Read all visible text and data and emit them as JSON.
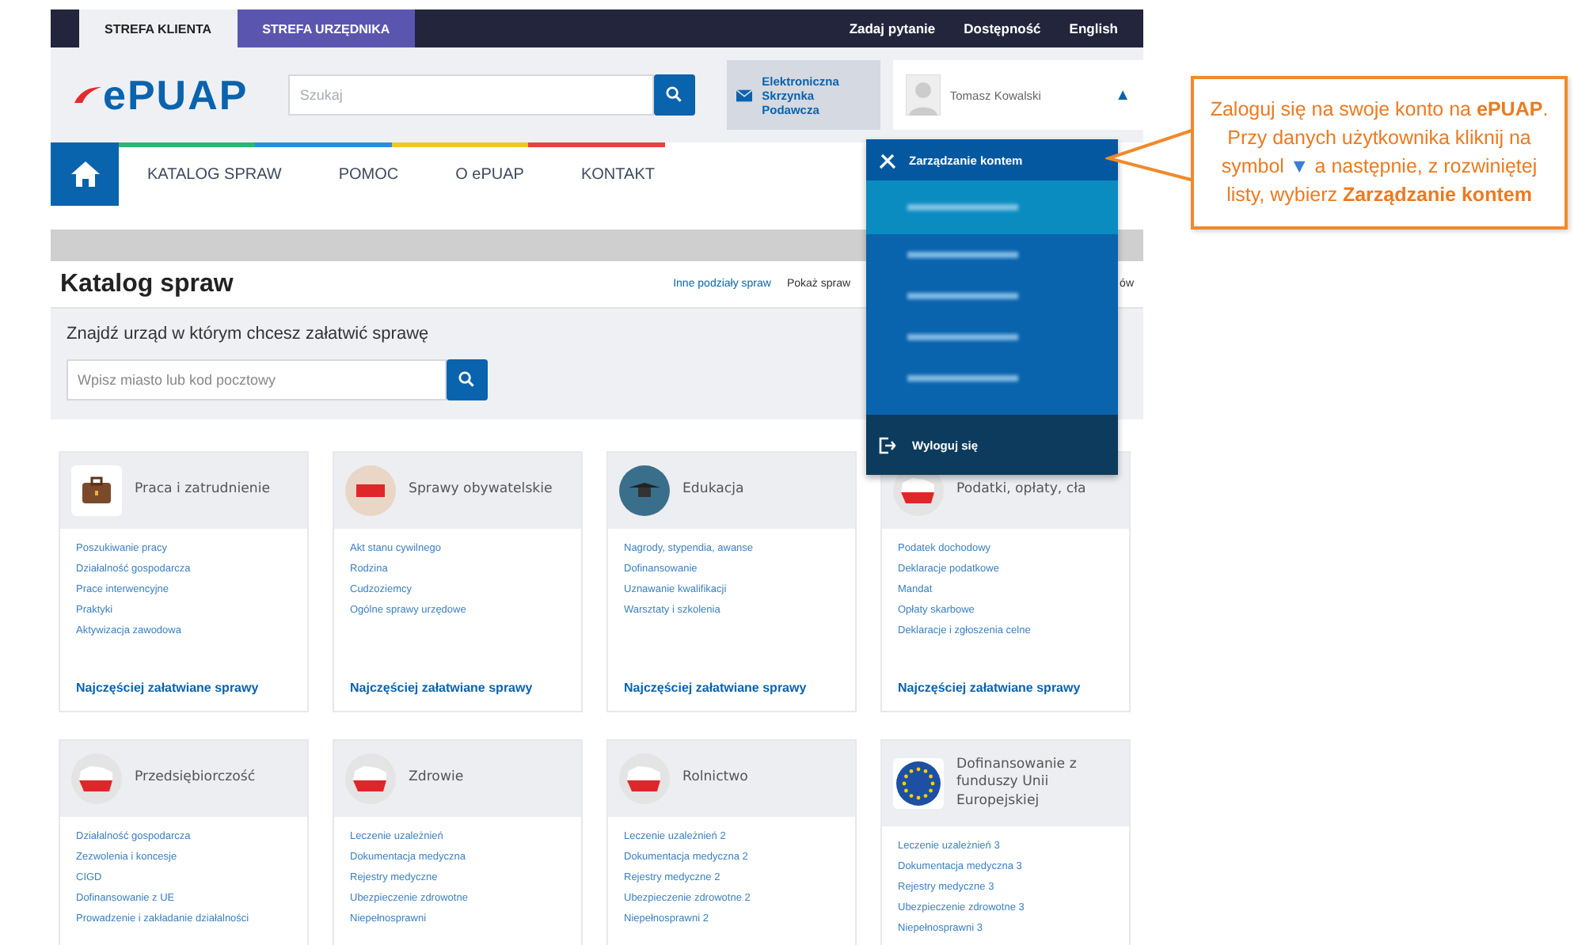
{
  "top_bar": {
    "tabs": [
      {
        "label": "STREFA KLIENTA",
        "selected": true
      },
      {
        "label": "STREFA URZĘDNIKA",
        "selected": false
      }
    ],
    "links": [
      "Zadaj pytanie",
      "Dostępność",
      "English"
    ]
  },
  "header": {
    "logo": "ePUAP",
    "search": {
      "placeholder": "Szukaj"
    },
    "inbox": "Elektroniczna Skrzynka Podawcza",
    "user": {
      "first_name": "Tomasz",
      "last_name": "Kowalski",
      "caret": "▲",
      "expanded": true
    }
  },
  "nav": [
    "KATALOG SPRAW",
    "POMOC",
    "O ePUAP",
    "KONTAKT"
  ],
  "user_menu": {
    "items": [
      {
        "label": "Zarządzanie kontem",
        "selected": true
      }
    ],
    "hidden_items": [
      {
        "highlighted": true
      },
      {
        "highlighted": false
      },
      {
        "highlighted": false
      },
      {
        "highlighted": false
      },
      {
        "highlighted": false
      }
    ],
    "logout": "Wyloguj się"
  },
  "catalog": {
    "title": "Katalog spraw",
    "links": [
      "Inne podziały spraw",
      "Pokaż spraw",
      "ów"
    ],
    "finder": {
      "label": "Znajdź urząd w którym chcesz załatwić sprawę",
      "placeholder": "Wpisz miasto lub kod pocztowy"
    },
    "categories": [
      {
        "title": "Praca i zatrudnienie",
        "kind": "briefcase",
        "items": [
          "Poszukiwanie pracy",
          "Działalność gospodarcza",
          "Prace interwencyjne",
          "Praktyki",
          "Aktywizacja zawodowa"
        ],
        "footer": "Najczęściej załatwiane sprawy"
      },
      {
        "title": "Sprawy obywatelskie",
        "kind": "sign",
        "items": [
          "Akt stanu cywilnego",
          "Rodzina",
          "Cudzoziemcy",
          "Ogólne sprawy urzędowe"
        ],
        "footer": "Najczęściej załatwiane sprawy"
      },
      {
        "title": "Edukacja",
        "kind": "cap",
        "items": [
          "Nagrody, stypendia, awanse",
          "Dofinansowanie",
          "Uznawanie kwalifikacji",
          "Warsztaty i szkolenia"
        ],
        "footer": "Najczęściej załatwiane sprawy"
      },
      {
        "title": "Podatki, opłaty, cła",
        "kind": "map",
        "items": [
          "Podatek dochodowy",
          "Deklaracje podatkowe",
          "Mandat",
          "Opłaty skarbowe",
          "Deklaracje i zgłoszenia celne"
        ],
        "footer": "Najczęściej załatwiane sprawy"
      },
      {
        "title": "Przedsiębiorczość",
        "kind": "map",
        "items": [
          "Działalność gospodarcza",
          "Zezwolenia i koncesje",
          "CIGD",
          "Dofinansowanie z UE",
          "Prowadzenie i zakładanie działalności"
        ]
      },
      {
        "title": "Zdrowie",
        "kind": "map",
        "items": [
          "Leczenie uzależnień",
          "Dokumentacja medyczna",
          "Rejestry medyczne",
          "Ubezpieczenie zdrowotne",
          "Niepełnosprawni"
        ]
      },
      {
        "title": "Rolnictwo",
        "kind": "map",
        "items": [
          "Leczenie uzależnień 2",
          "Dokumentacja medyczna 2",
          "Rejestry medyczne 2",
          "Ubezpieczenie zdrowotne 2",
          "Niepełnosprawni 2"
        ]
      },
      {
        "title": "Dofinansowanie z funduszy Unii Europejskiej",
        "kind": "eu",
        "items": [
          "Leczenie uzależnień 3",
          "Dokumentacja medyczna 3",
          "Rejestry medyczne 3",
          "Ubezpieczenie zdrowotne 3",
          "Niepełnosprawni 3"
        ]
      }
    ]
  },
  "callout": {
    "first": "Zaloguj się na swoje konto na **ePUAP**.",
    "before": "Przy danych użytkownika kliknij na symbol",
    "symbol": "▼",
    "after": "a następnie, z rozwiniętej listy, wybierz **Zarządzanie kontem**"
  }
}
